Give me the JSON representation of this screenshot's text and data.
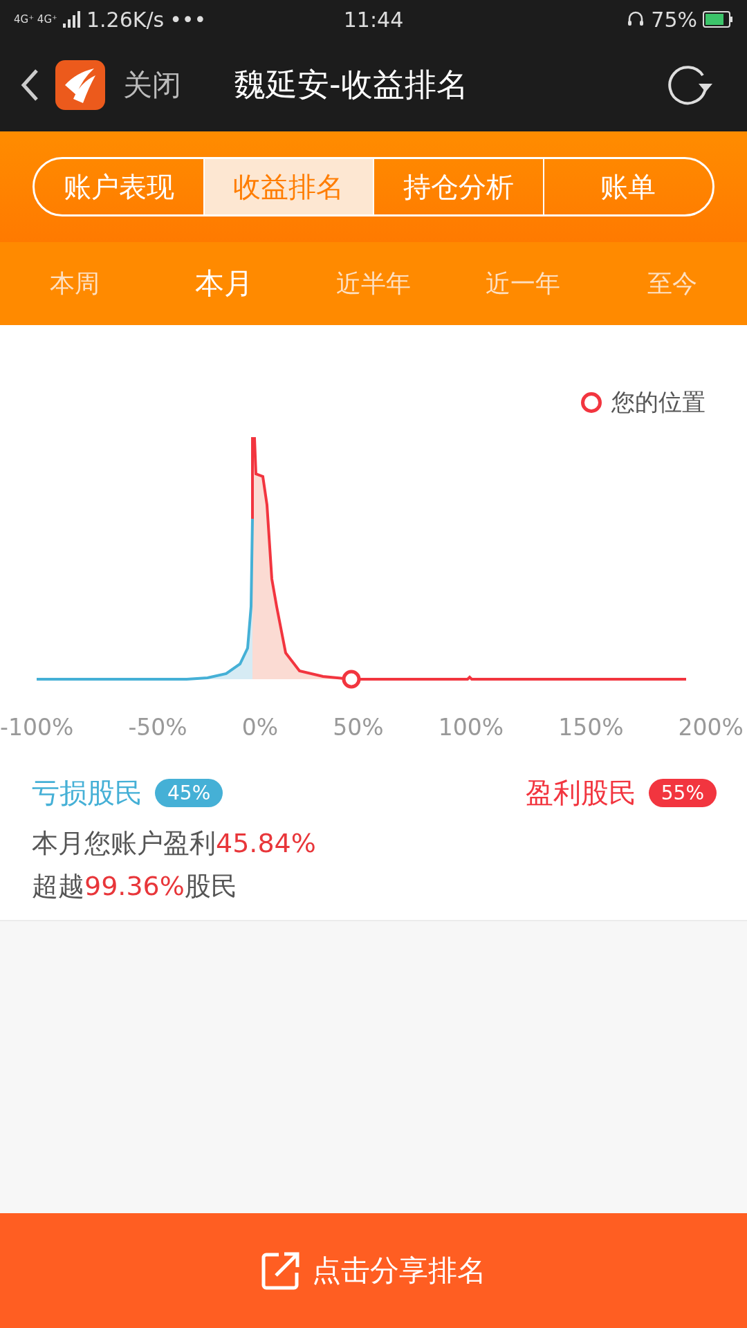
{
  "status_bar": {
    "network": "4G⁺ 4G⁺",
    "speed": "1.26K/s",
    "more": "•••",
    "time": "11:44",
    "battery": "75%"
  },
  "header": {
    "close": "关闭",
    "title": "魏延安-收益排名"
  },
  "tabs": [
    {
      "label": "账户表现",
      "selected": false
    },
    {
      "label": "收益排名",
      "selected": true
    },
    {
      "label": "持仓分析",
      "selected": false
    },
    {
      "label": "账单",
      "selected": false
    }
  ],
  "periods": [
    {
      "label": "本周",
      "selected": false
    },
    {
      "label": "本月",
      "selected": true
    },
    {
      "label": "近半年",
      "selected": false
    },
    {
      "label": "近一年",
      "selected": false
    },
    {
      "label": "至今",
      "selected": false
    }
  ],
  "chart": {
    "legend": "您的位置",
    "axis_labels": [
      "-100%",
      "-50%",
      "0%",
      "50%",
      "100%",
      "150%",
      "200%"
    ]
  },
  "groups": [
    {
      "label": "亏损股民",
      "badge": "45%",
      "color": "#45b0d6"
    },
    {
      "label": "盈利股民",
      "badge": "55%",
      "color": "#f2353f"
    }
  ],
  "summary": [
    {
      "prefix": "本月您账户盈利",
      "value": "45.84%"
    },
    {
      "prefix": "超越",
      "value": "99.36%",
      "suffix": "股民"
    }
  ],
  "share_button": "点击分享排名"
}
